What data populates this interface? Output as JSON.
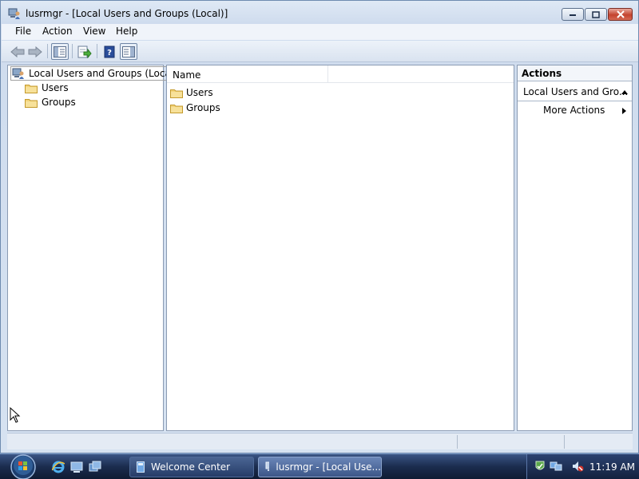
{
  "window": {
    "title": "lusrmgr - [Local Users and Groups (Local)]"
  },
  "menu": [
    "File",
    "Action",
    "View",
    "Help"
  ],
  "tree": {
    "root": "Local Users and Groups (Local)",
    "children": [
      "Users",
      "Groups"
    ]
  },
  "list": {
    "columns": [
      "Name"
    ],
    "items": [
      "Users",
      "Groups"
    ]
  },
  "actions": {
    "title": "Actions",
    "section": "Local Users and Gro...",
    "more": "More Actions"
  },
  "taskbar": {
    "tasks": [
      "Welcome Center",
      "lusrmgr - [Local Use..."
    ],
    "clock": "11:19 AM"
  },
  "colors": {
    "window_frame": "#dfe9f5",
    "taskbar": "#1b2c4e",
    "close_button": "#c4432f"
  }
}
